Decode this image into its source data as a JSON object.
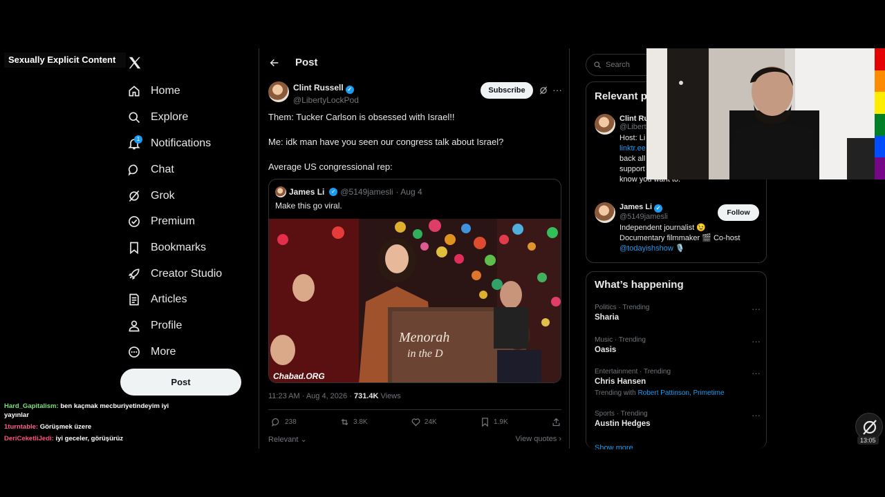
{
  "overlay": {
    "label": "Sexually Explicit Content"
  },
  "nav": {
    "items": [
      {
        "label": "Home",
        "icon": "home-icon"
      },
      {
        "label": "Explore",
        "icon": "search-icon"
      },
      {
        "label": "Notifications",
        "icon": "bell-icon",
        "badge": "1"
      },
      {
        "label": "Chat",
        "icon": "chat-icon"
      },
      {
        "label": "Grok",
        "icon": "grok-icon"
      },
      {
        "label": "Premium",
        "icon": "premium-icon"
      },
      {
        "label": "Bookmarks",
        "icon": "bookmark-icon"
      },
      {
        "label": "Creator Studio",
        "icon": "rocket-icon"
      },
      {
        "label": "Articles",
        "icon": "articles-icon"
      },
      {
        "label": "Profile",
        "icon": "profile-icon"
      },
      {
        "label": "More",
        "icon": "more-icon"
      }
    ],
    "post_button": "Post"
  },
  "chat": [
    {
      "user": "Hard_Gapitalism:",
      "message": "ben kaçmak mecburiyetindeyim iyi yayınlar"
    },
    {
      "user": "1turntable:",
      "message": "Görüşmek üzere"
    },
    {
      "user": "DeriCeketliJedi:",
      "message": "iyi geceler, görüşürüz"
    }
  ],
  "main": {
    "header_title": "Post",
    "author": {
      "name": "Clint Russell",
      "handle": "@LibertyLockPod"
    },
    "subscribe_label": "Subscribe",
    "text_lines": [
      "Them: Tucker Carlson is obsessed with Israel!!",
      "Me: idk man have you seen our congress talk about Israel?",
      "Average US congressional rep:"
    ],
    "quote": {
      "name": "James Li",
      "handle": "@5149jamesli",
      "date": "· Aug 4",
      "text": "Make this go viral.",
      "podium_line1": "Menorah",
      "podium_line2": "in the D",
      "watermark": "Chabad.ORG"
    },
    "timestamp": "11:23 AM · Aug 4, 2026 ·",
    "views_count": "731.4K",
    "views_label": "Views",
    "actions": {
      "replies": "238",
      "reposts": "3.8K",
      "likes": "24K",
      "bookmarks": "1.9K"
    },
    "sort_label": "Relevant",
    "view_quotes": "View quotes"
  },
  "sidebar": {
    "search_placeholder": "Search",
    "relevant_title": "Relevant p",
    "person1": {
      "name": "Clint Ru",
      "handle": "@Libert",
      "bio_lines": [
        "Host: Li",
        "linktr.ee",
        "back all",
        "support",
        "know you want to."
      ]
    },
    "person2": {
      "name": "James Li",
      "handle": "@5149jamesli",
      "bio_line1": "Independent journalist 😉",
      "bio_line2": "Documentary filmmaker 🎬 Co-host",
      "bio_link": "@todayishshow",
      "bio_link_suffix": "🎙️",
      "follow_label": "Follow"
    },
    "happening_title": "What’s happening",
    "trends": [
      {
        "category": "Politics · Trending",
        "name": "Sharia"
      },
      {
        "category": "Music · Trending",
        "name": "Oasis"
      },
      {
        "category": "Entertainment · Trending",
        "name": "Chris Hansen",
        "with_label": "Trending with",
        "with_links": "Robert Pattinson, Primetime"
      },
      {
        "category": "Sports · Trending",
        "name": "Austin Hedges"
      }
    ],
    "show_more": "Show more"
  },
  "clock": "13:05",
  "colors": {
    "accent": "#1d9bf0",
    "background": "#000000",
    "border": "#2f3336",
    "muted": "#71767b"
  }
}
